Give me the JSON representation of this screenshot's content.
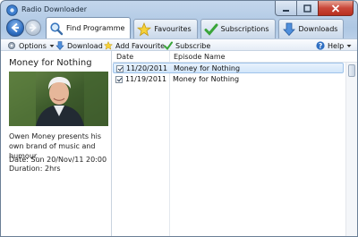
{
  "window": {
    "title": "Radio Downloader"
  },
  "tabs": [
    {
      "label": "Find Programme",
      "icon": "magnifier-icon",
      "active": true
    },
    {
      "label": "Favourites",
      "icon": "star-icon",
      "active": false
    },
    {
      "label": "Subscriptions",
      "icon": "checkmark-icon",
      "active": false
    },
    {
      "label": "Downloads",
      "icon": "download-arrow-icon",
      "active": false
    }
  ],
  "toolbar": {
    "options_label": "Options",
    "download_label": "Download",
    "add_favourite_label": "Add Favourite",
    "subscribe_label": "Subscribe",
    "help_label": "Help"
  },
  "programme": {
    "title": "Money for Nothing",
    "description": "Owen Money presents his own brand of music and humour.",
    "date": "Date: Sun 20/Nov/11 20:00",
    "duration": "Duration: 2hrs"
  },
  "episodes": {
    "columns": [
      "Date",
      "Episode Name"
    ],
    "rows": [
      {
        "date": "11/20/2011",
        "name": "Money for Nothing",
        "checked": true,
        "selected": true
      },
      {
        "date": "11/19/2011",
        "name": "Money for Nothing",
        "checked": true,
        "selected": false
      }
    ]
  },
  "colors": {
    "accent": "#2f6fc2",
    "selection": "#d3e6fa",
    "window_frame": "#aec7e3"
  }
}
